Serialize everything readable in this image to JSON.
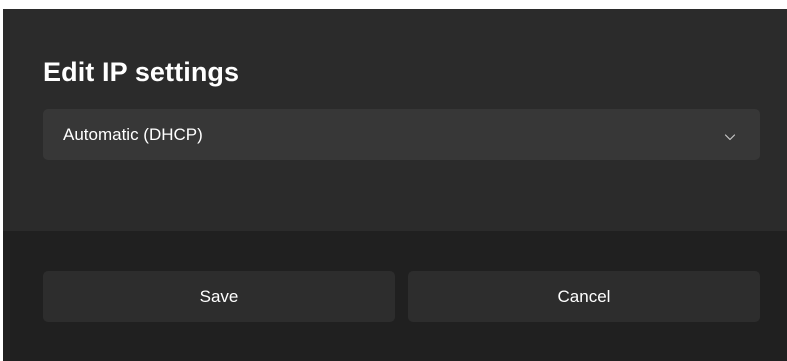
{
  "dialog": {
    "title": "Edit IP settings",
    "dropdown": {
      "selected": "Automatic (DHCP)",
      "icon": "chevron-down-icon"
    },
    "buttons": {
      "save_label": "Save",
      "cancel_label": "Cancel"
    }
  },
  "colors": {
    "content_background": "#2b2b2b",
    "footer_background": "#202020",
    "control_background": "#373737",
    "button_background": "#2d2d2d",
    "text": "#ffffff"
  }
}
